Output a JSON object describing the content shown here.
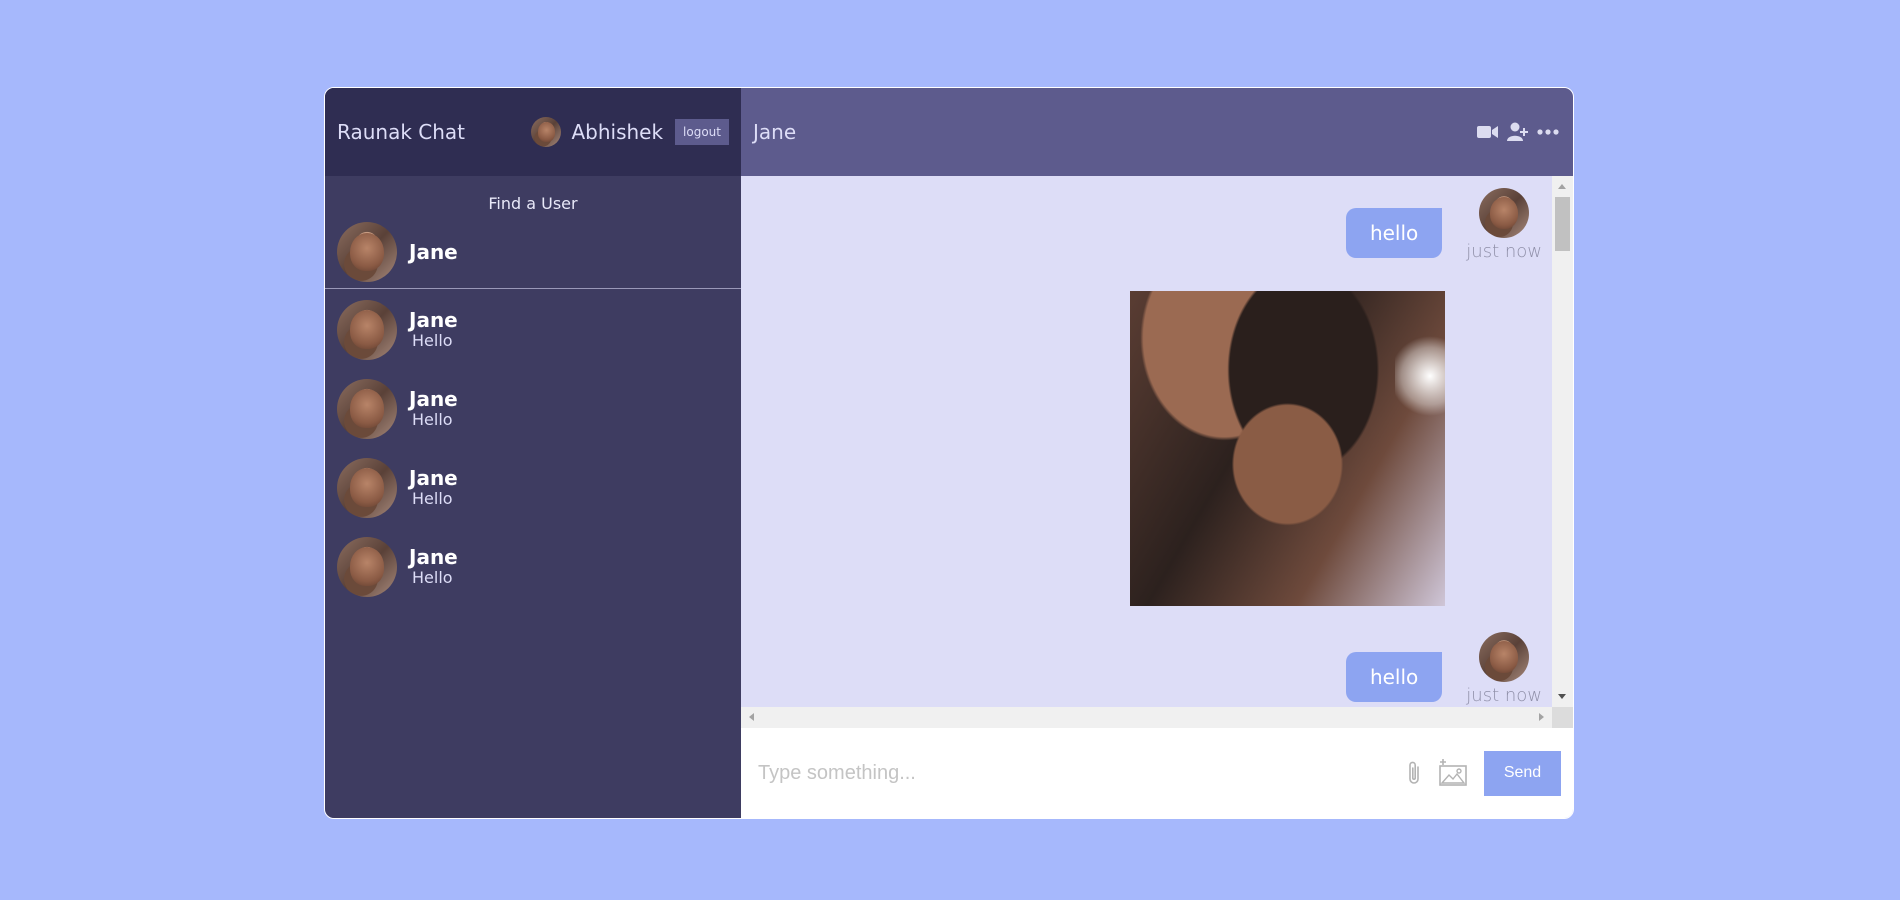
{
  "sidebar": {
    "brand": "Raunak Chat",
    "current_user": {
      "name": "Abhishek",
      "avatar": "user-avatar"
    },
    "logout_label": "logout",
    "search": {
      "placeholder": "Find a User",
      "value": ""
    },
    "search_result": {
      "name": "Jane"
    },
    "chats": [
      {
        "name": "Jane",
        "last_message": "Hello"
      },
      {
        "name": "Jane",
        "last_message": "Hello"
      },
      {
        "name": "Jane",
        "last_message": "Hello"
      },
      {
        "name": "Jane",
        "last_message": "Hello"
      }
    ]
  },
  "chat": {
    "title": "Jane",
    "header_icons": [
      "video-camera-icon",
      "add-user-icon",
      "more-options-icon"
    ],
    "messages": [
      {
        "type": "text",
        "text": "hello",
        "time": "just now",
        "owner": true
      },
      {
        "type": "image",
        "alt": "photo",
        "owner": true
      },
      {
        "type": "text",
        "text": "hello",
        "time": "just now",
        "owner": true
      }
    ]
  },
  "input": {
    "placeholder": "Type something...",
    "value": "",
    "send_label": "Send",
    "icons": [
      "attachment-icon",
      "add-image-icon"
    ]
  },
  "colors": {
    "page_background": "#a6b8fc",
    "sidebar": "#3e3c61",
    "sidebar_header": "#2f2d52",
    "chat_header": "#5d5b8d",
    "messages_background": "#ddddf7",
    "bubble": "#8da4f1",
    "send_button": "#8da4f1"
  }
}
